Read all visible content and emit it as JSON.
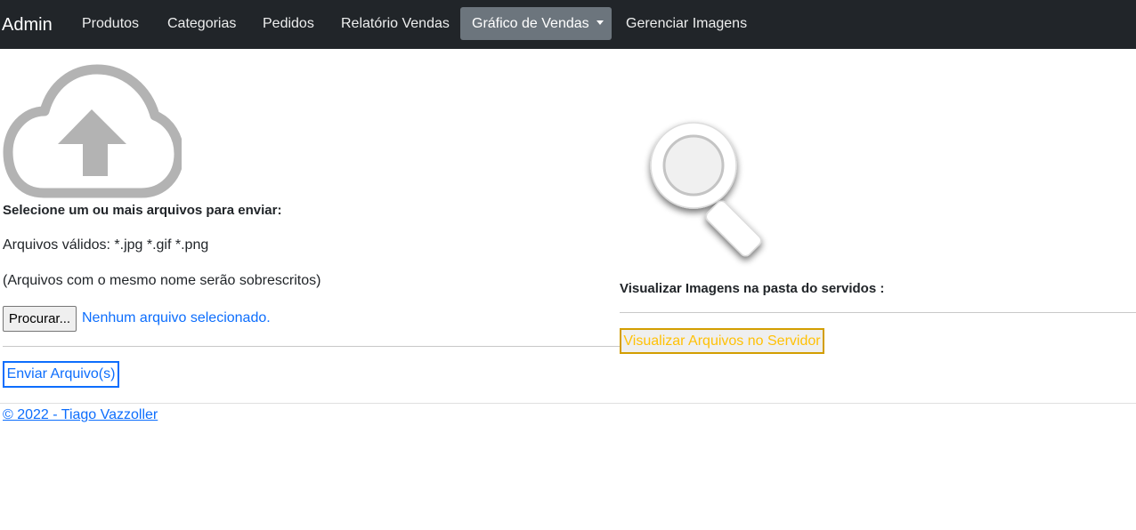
{
  "navbar": {
    "brand": "Admin",
    "items": [
      {
        "label": "Produtos"
      },
      {
        "label": "Categorias"
      },
      {
        "label": "Pedidos"
      },
      {
        "label": "Relatório Vendas"
      },
      {
        "label": "Gráfico de Vendas",
        "active": true,
        "dropdown": true
      },
      {
        "label": "Gerenciar Imagens"
      }
    ]
  },
  "upload": {
    "icon": "cloud-upload-icon",
    "heading": "Selecione um ou mais arquivos para enviar:",
    "valid_files": "Arquivos válidos: *.jpg *.gif *.png",
    "overwrite_note": "(Arquivos com o mesmo nome serão sobrescritos)",
    "browse_label": "Procurar...",
    "file_status": "Nenhum arquivo selecionado.",
    "send_label": "Enviar Arquivo(s)"
  },
  "viewer": {
    "icon": "magnifier-icon",
    "heading": "Visualizar Imagens na pasta do servidos :",
    "button_label": "Visualizar Arquivos no Servidor"
  },
  "footer": {
    "link": "© 2022 - Tiago Vazzoller"
  },
  "colors": {
    "navbar_bg": "#212529",
    "active_item_bg": "#6c757d",
    "primary": "#0d6efd",
    "warning": "#ffc107",
    "icon_gray": "#b3b3b3"
  }
}
